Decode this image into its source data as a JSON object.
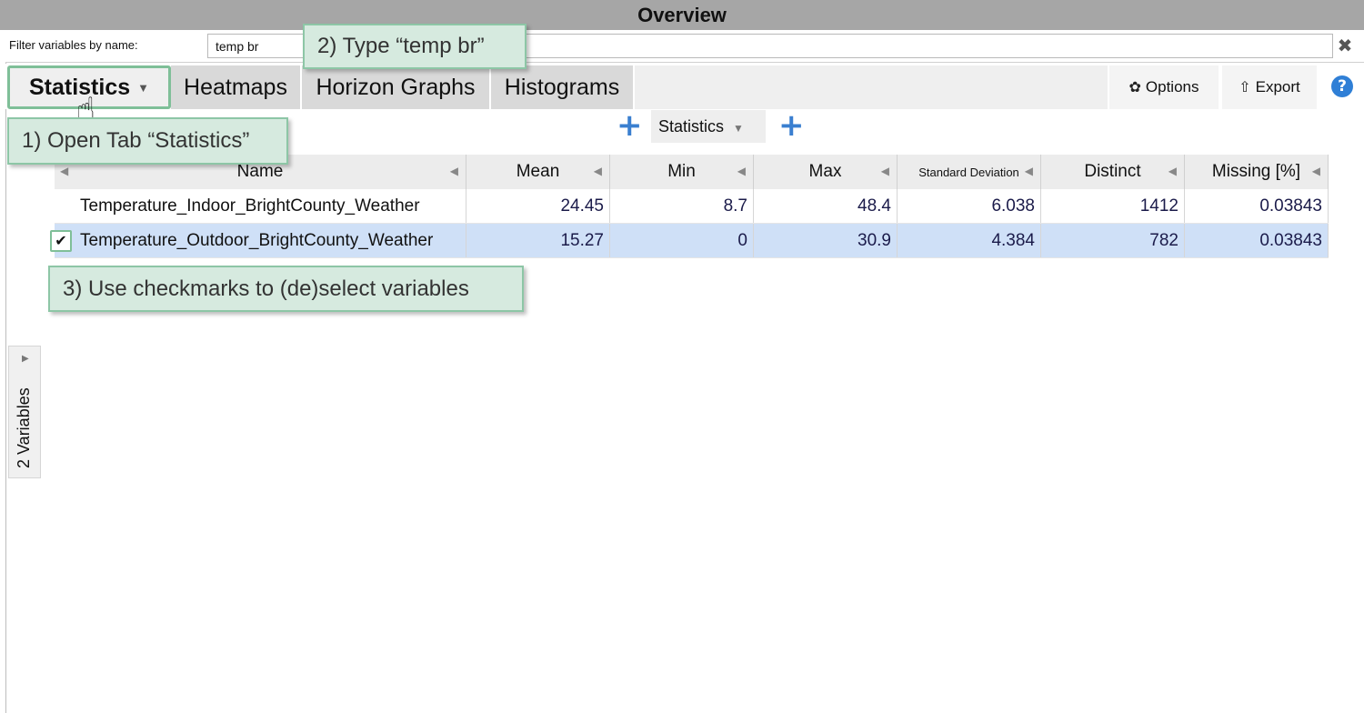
{
  "window": {
    "title": "Overview"
  },
  "filter": {
    "label": "Filter variables by name:",
    "value": "temp br"
  },
  "tabs": [
    {
      "label": "Statistics",
      "active": true
    },
    {
      "label": "Heatmaps"
    },
    {
      "label": "Horizon Graphs"
    },
    {
      "label": "Histograms"
    }
  ],
  "toolbar": {
    "options_label": "Options",
    "export_label": "Export"
  },
  "stats_selector": {
    "label": "Statistics"
  },
  "table": {
    "columns": [
      "Name",
      "Mean",
      "Min",
      "Max",
      "Standard Deviation",
      "Distinct",
      "Missing [%]"
    ],
    "rows": [
      {
        "name": "Temperature_Indoor_BrightCounty_Weather",
        "mean": "24.45",
        "min": "8.7",
        "max": "48.4",
        "sd": "6.038",
        "distinct": "1412",
        "missing": "0.03843",
        "selected": false
      },
      {
        "name": "Temperature_Outdoor_BrightCounty_Weather",
        "mean": "15.27",
        "min": "0",
        "max": "30.9",
        "sd": "4.384",
        "distinct": "782",
        "missing": "0.03843",
        "selected": true
      }
    ]
  },
  "side_panel": {
    "label": "2 Variables"
  },
  "callouts": {
    "step1": "1) Open Tab “Statistics”",
    "step2": "2) Type “temp br”",
    "step3": "3) Use checkmarks to (de)select variables"
  },
  "colors": {
    "accent_green": "#7fbf98",
    "selected_row": "#cfe0f7",
    "title_bar": "#a6a6a6",
    "plus_blue": "#3a7fd0"
  }
}
